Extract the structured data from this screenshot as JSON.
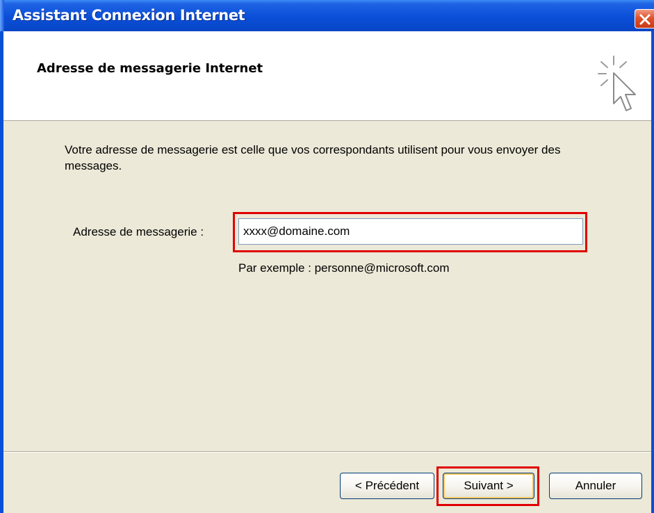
{
  "window": {
    "title": "Assistant Connexion Internet"
  },
  "header": {
    "title": "Adresse de messagerie Internet",
    "icon": "wizard-cursor-icon"
  },
  "content": {
    "description": "Votre adresse de messagerie est celle que vos correspondants utilisent pour vous envoyer des messages.",
    "email": {
      "label": "Adresse de messagerie :",
      "value": "xxxx@domaine.com",
      "example": "Par exemple : personne@microsoft.com"
    }
  },
  "buttons": {
    "previous": "< Précédent",
    "next": "Suivant >",
    "cancel": "Annuler"
  },
  "colors": {
    "titlebar": "#0a50d6",
    "dialog_bg": "#ece9d8",
    "highlight": "#e00000",
    "close_button": "#e0522c"
  }
}
